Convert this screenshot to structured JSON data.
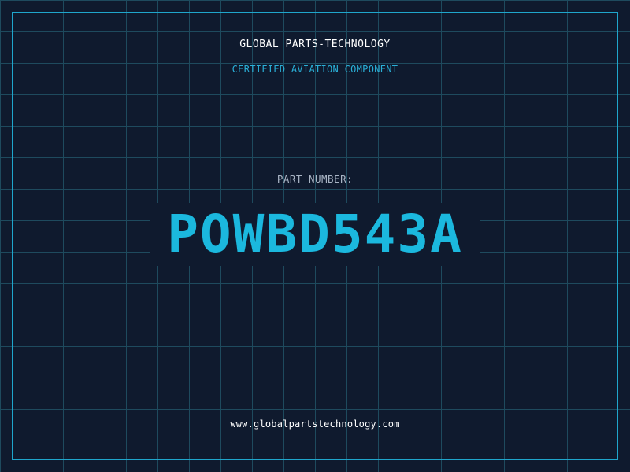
{
  "header": {
    "company": "GLOBAL PARTS-TECHNOLOGY",
    "subtitle": "CERTIFIED AVIATION COMPONENT"
  },
  "part": {
    "label": "PART NUMBER:",
    "number": "POWBD543A"
  },
  "footer": {
    "website": "www.globalpartstechnology.com"
  },
  "colors": {
    "background": "#0f1a2e",
    "grid": "#1e4a5e",
    "accent": "#1fa6cc",
    "part_number": "#1bb8de",
    "label": "#a8b4c4",
    "text": "#ffffff"
  }
}
